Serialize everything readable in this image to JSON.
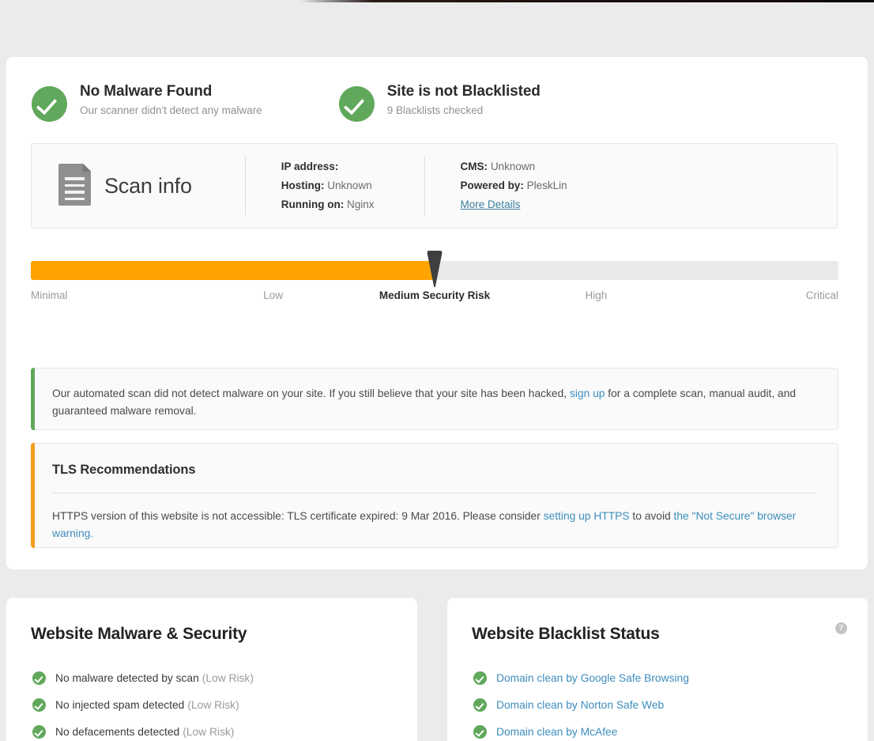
{
  "statuses": [
    {
      "icon": "check-circle-icon",
      "title": "No Malware Found",
      "subtitle": "Our scanner didn't detect any malware"
    },
    {
      "icon": "check-circle-icon",
      "title": "Site is not Blacklisted",
      "subtitle": "9 Blacklists checked"
    }
  ],
  "scan_info": {
    "icon": "document-icon",
    "title": "Scan info",
    "left_column": [
      {
        "label": "IP address:",
        "value": ""
      },
      {
        "label": "Hosting:",
        "value": "Unknown"
      },
      {
        "label": "Running on:",
        "value": "Nginx"
      }
    ],
    "right_column": [
      {
        "label": "CMS:",
        "value": "Unknown"
      },
      {
        "label": "Powered by:",
        "value": "PleskLin"
      }
    ],
    "more_details_label": "More Details"
  },
  "gauge": {
    "fill_percent": 50,
    "marker_percent": 50,
    "fill_color": "#ffa300",
    "track_color": "#eaeaea",
    "marker_color": "#3f3f3f",
    "active_label": "Medium Security Risk",
    "labels": [
      {
        "text": "Minimal",
        "position_percent": 0,
        "align": "left",
        "active": false
      },
      {
        "text": "Low",
        "position_percent": 30,
        "align": "center",
        "active": false
      },
      {
        "text": "Medium Security Risk",
        "position_percent": 50,
        "align": "center",
        "active": true
      },
      {
        "text": "High",
        "position_percent": 70,
        "align": "center",
        "active": false
      },
      {
        "text": "Critical",
        "position_percent": 100,
        "align": "right",
        "active": false
      }
    ]
  },
  "scan_alert": {
    "accent_color": "#60a85b",
    "text_before": "Our automated scan did not detect malware on your site. If you still believe that your site has been hacked, ",
    "link_text": "sign up",
    "text_after": " for a complete scan, manual audit, and guaranteed malware removal."
  },
  "tls_panel": {
    "accent_color": "#f59d1f",
    "heading": "TLS Recommendations",
    "text_1": "HTTPS version of this website is not accessible: TLS certificate expired: 9 Mar 2016. Please consider ",
    "link_1": "setting up HTTPS",
    "text_2": " to avoid ",
    "link_2": "the \"Not Secure\" browser warning."
  },
  "malware_card": {
    "heading": "Website Malware & Security",
    "items": [
      {
        "label": "No malware detected by scan",
        "risk": "(Low Risk)",
        "is_link": false
      },
      {
        "label": "No injected spam detected",
        "risk": "(Low Risk)",
        "is_link": false
      },
      {
        "label": "No defacements detected",
        "risk": "(Low Risk)",
        "is_link": false
      }
    ]
  },
  "blacklist_card": {
    "heading": "Website Blacklist Status",
    "help_icon": "help-question-icon",
    "help_glyph": "?",
    "items": [
      {
        "label": "Domain clean by Google Safe Browsing",
        "risk": "",
        "is_link": true
      },
      {
        "label": "Domain clean by Norton Safe Web",
        "risk": "",
        "is_link": true
      },
      {
        "label": "Domain clean by McAfee",
        "risk": "",
        "is_link": true
      }
    ]
  }
}
